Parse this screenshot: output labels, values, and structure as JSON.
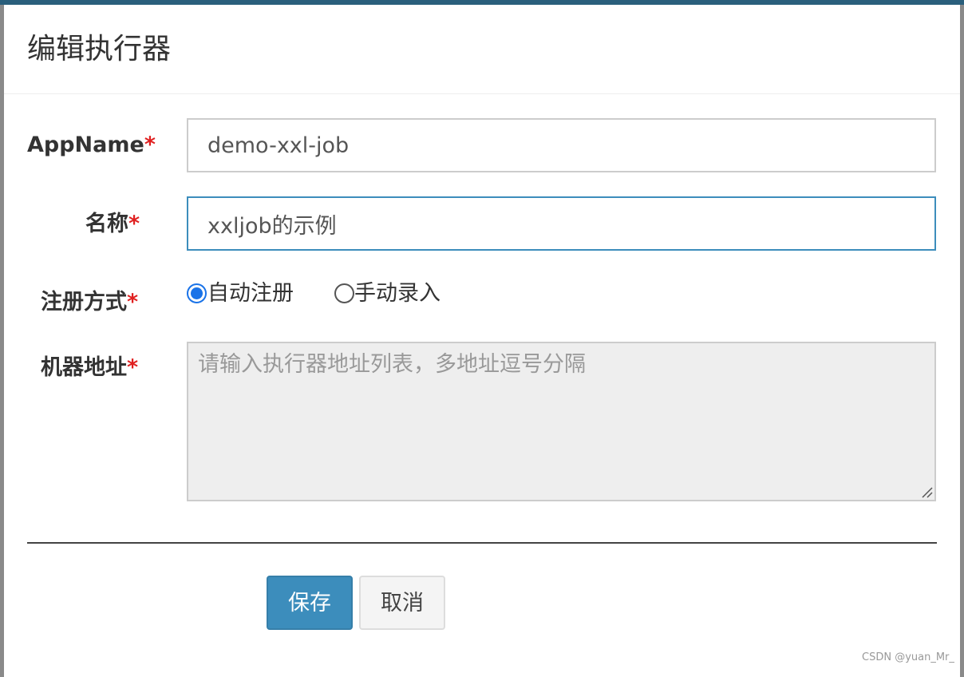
{
  "dialog": {
    "title": "编辑执行器"
  },
  "form": {
    "required_mark": "*",
    "appname": {
      "label": "AppName",
      "value": "demo-xxl-job"
    },
    "name": {
      "label": "名称",
      "value": "xxljob的示例"
    },
    "registration": {
      "label": "注册方式",
      "options": [
        {
          "label": "自动注册",
          "checked": true
        },
        {
          "label": "手动录入",
          "checked": false
        }
      ]
    },
    "address": {
      "label": "机器地址",
      "placeholder": "请输入执行器地址列表，多地址逗号分隔"
    }
  },
  "buttons": {
    "save": "保存",
    "cancel": "取消"
  },
  "watermark": "CSDN @yuan_Mr_",
  "colors": {
    "primary": "#3c8dbc",
    "required": "#e02020",
    "radio_checked": "#1a73e8",
    "topbar": "#2a5f7c"
  }
}
